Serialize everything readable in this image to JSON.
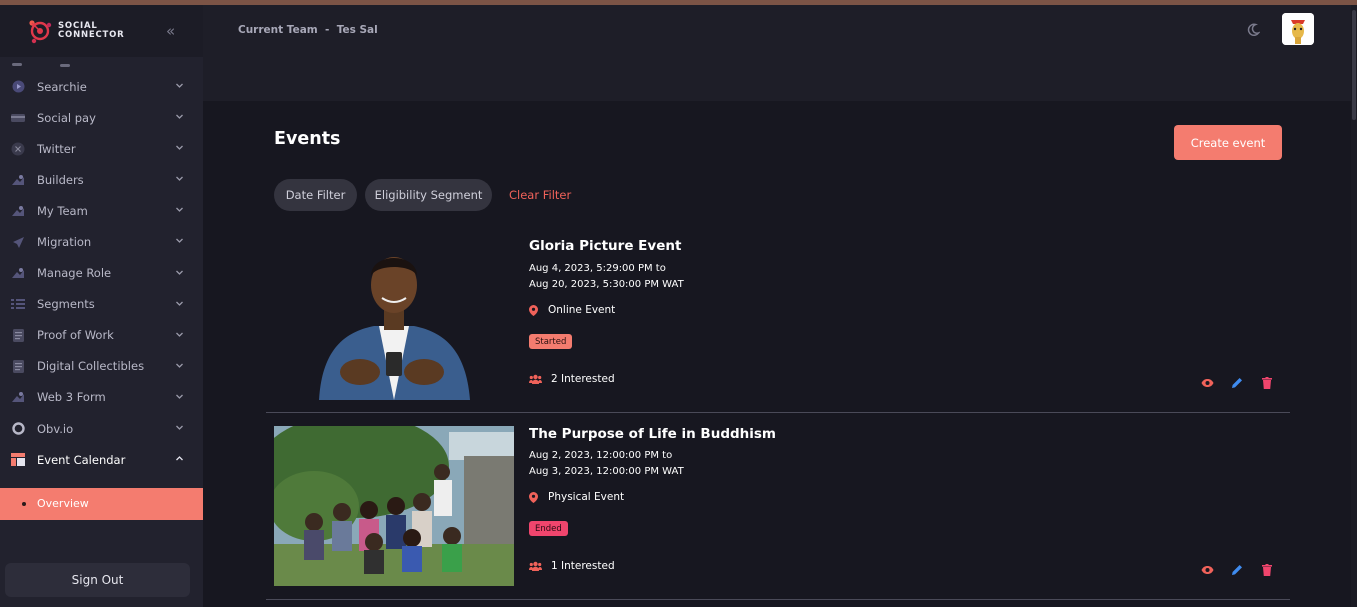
{
  "app": {
    "logo_line1": "SOCIAL",
    "logo_line2": "CONNECTOR",
    "accent": "#f47c6f"
  },
  "header": {
    "team_label": "Current Team  -  Tes Sal"
  },
  "sidebar": {
    "items": [
      {
        "label": "Searchie",
        "icon": "play-circle-icon"
      },
      {
        "label": "Social pay",
        "icon": "card-icon"
      },
      {
        "label": "Twitter",
        "icon": "x-icon"
      },
      {
        "label": "Builders",
        "icon": "tools-icon"
      },
      {
        "label": "My Team",
        "icon": "tools-icon"
      },
      {
        "label": "Migration",
        "icon": "send-icon"
      },
      {
        "label": "Manage Role",
        "icon": "tools-icon"
      },
      {
        "label": "Segments",
        "icon": "list-icon"
      },
      {
        "label": "Proof of Work",
        "icon": "document-icon"
      },
      {
        "label": "Digital Collectibles",
        "icon": "document-icon"
      },
      {
        "label": "Web 3 Form",
        "icon": "tools-icon"
      },
      {
        "label": "Obv.io",
        "icon": "circle-icon"
      },
      {
        "label": "Event Calendar",
        "icon": "calendar-icon"
      }
    ],
    "sub_item": "Overview",
    "sign_out": "Sign Out"
  },
  "main": {
    "title": "Events",
    "create_button": "Create event",
    "filters": {
      "date": "Date Filter",
      "eligibility": "Eligibility Segment",
      "clear": "Clear Filter"
    },
    "events": [
      {
        "name": "Gloria Picture Event",
        "date_from": "Aug 4, 2023, 5:29:00 PM to",
        "date_to": "Aug 20, 2023, 5:30:00 PM WAT",
        "location": "Online Event",
        "status": "Started",
        "interested": "2 Interested"
      },
      {
        "name": "The Purpose of Life in Buddhism",
        "date_from": "Aug 2, 2023, 12:00:00 PM to",
        "date_to": "Aug 3, 2023, 12:00:00 PM WAT",
        "location": "Physical Event",
        "status": "Ended",
        "interested": "1 Interested"
      }
    ]
  }
}
